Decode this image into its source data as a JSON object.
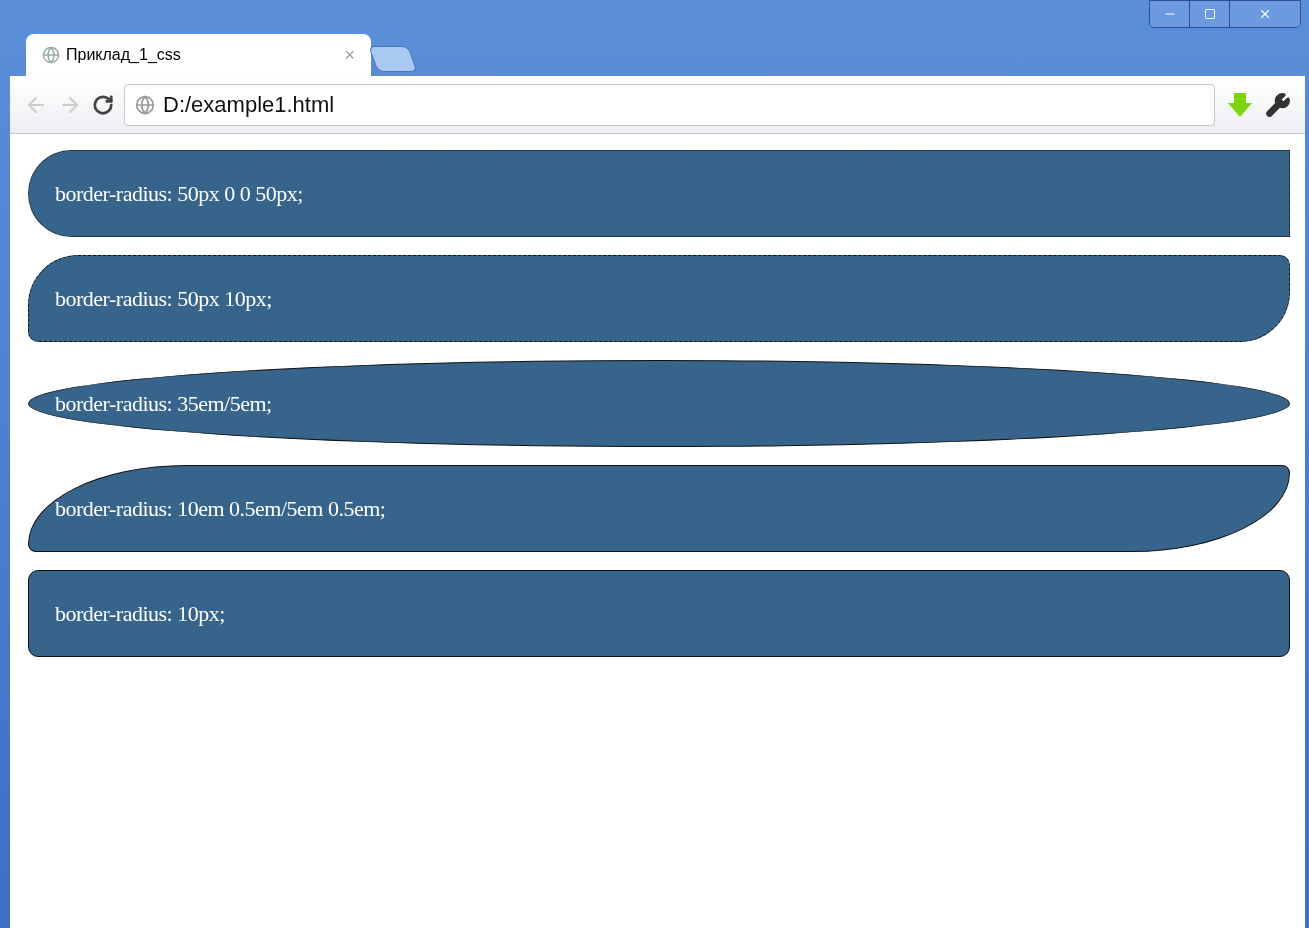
{
  "tab": {
    "title": "Приклад_1_css",
    "close": "×",
    "selected": true
  },
  "address_bar": {
    "value": "D:/example1.html"
  },
  "boxes": [
    {
      "kind": "left-rounded",
      "text": "border-radius: 50px 0 0 50px;"
    },
    {
      "kind": "diagonal",
      "text": "border-radius: 50px 10px;"
    },
    {
      "kind": "ellipse",
      "text": "border-radius: 35em/5em;"
    },
    {
      "kind": "swoosh",
      "text": "border-radius: 10em 0.5em/5em 0.5em;"
    },
    {
      "kind": "rounded",
      "text": "border-radius: 10px;"
    }
  ]
}
